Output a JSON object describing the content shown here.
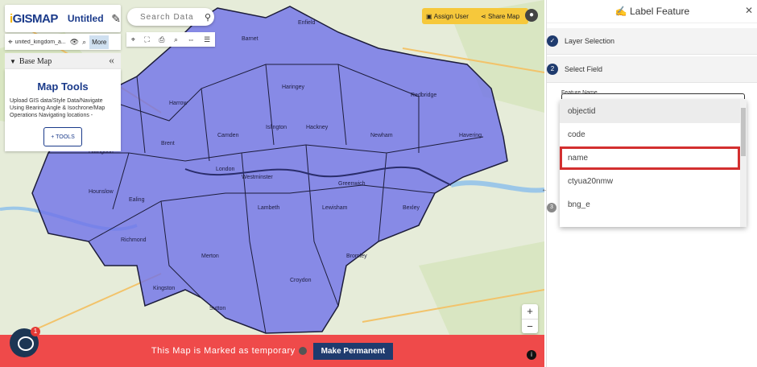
{
  "app": {
    "logo": "GISMAP",
    "title": "Untitled ..."
  },
  "layer": {
    "name": "united_kingdom_a...",
    "more_label": "More"
  },
  "basemap": {
    "label": "Base Map"
  },
  "tools": {
    "title": "Map Tools",
    "description": "Upload GIS data/Style Data/Navigate Using Bearing Angle & Isochrone/Map Operations Navigating locations -",
    "button": "+ TOOLS"
  },
  "search": {
    "placeholder": "Search Data"
  },
  "actions": {
    "assign": "Assign User",
    "share": "Share Map"
  },
  "zoom": {
    "in": "+",
    "out": "−"
  },
  "banner": {
    "text": "This Map is Marked as temporary",
    "button": "Make Permanent"
  },
  "chat": {
    "badge": "1"
  },
  "panel": {
    "title": "Label Feature",
    "steps": [
      {
        "number": "1",
        "label": "Layer Selection"
      },
      {
        "number": "2",
        "label": "Select Field"
      },
      {
        "number": "3",
        "label": ""
      }
    ],
    "field_label": "Feature Name",
    "options": [
      "objectid",
      "code",
      "name",
      "ctyua20nmw",
      "bng_e"
    ],
    "selected_option": "name"
  },
  "map_labels": [
    "London",
    "Westminster",
    "Greenwich",
    "Sutton",
    "Croydon",
    "Bromley",
    "Bexley",
    "Hillingdon",
    "Harrow",
    "Barnet",
    "Enfield",
    "Havering",
    "Ealing",
    "Camden",
    "Islington",
    "Hackney",
    "Newham",
    "Lambeth",
    "Lewisham",
    "Merton",
    "Richmond",
    "Kingston",
    "Hounslow",
    "Redbridge",
    "Haringey",
    "Brent"
  ]
}
